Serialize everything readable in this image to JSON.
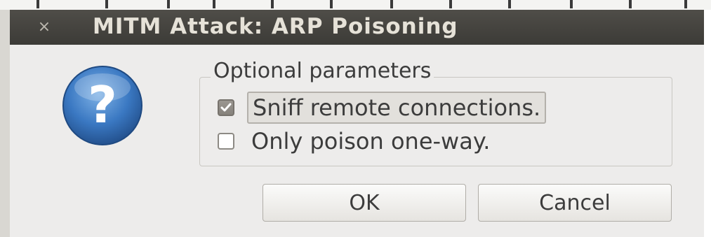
{
  "window": {
    "title": "MITM Attack: ARP Poisoning",
    "close_glyph": "×"
  },
  "icon": {
    "name": "question-icon",
    "glyph": "?",
    "color": "#3a78c2"
  },
  "group": {
    "legend": "Optional parameters",
    "options": [
      {
        "label": "Sniff remote connections.",
        "checked": true
      },
      {
        "label": "Only poison one-way.",
        "checked": false
      }
    ]
  },
  "buttons": {
    "ok_label": "OK",
    "cancel_label": "Cancel"
  },
  "colors": {
    "titlebar": "#3c3b37",
    "dialog_bg": "#edeceb",
    "accent_blue": "#3a78c2"
  }
}
